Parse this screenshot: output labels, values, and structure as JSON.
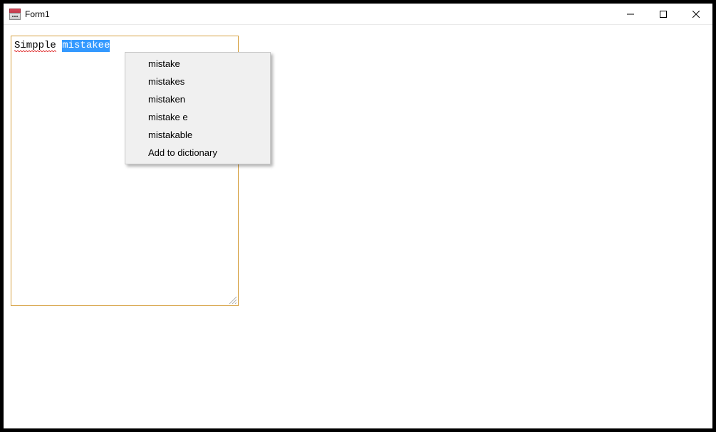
{
  "window": {
    "title": "Form1"
  },
  "textbox": {
    "word1": "Simpple",
    "word2": "mistakee"
  },
  "context_menu": {
    "items": [
      "mistake",
      "mistakes",
      "mistaken",
      "mistake e",
      "mistakable",
      "Add to dictionary"
    ]
  }
}
